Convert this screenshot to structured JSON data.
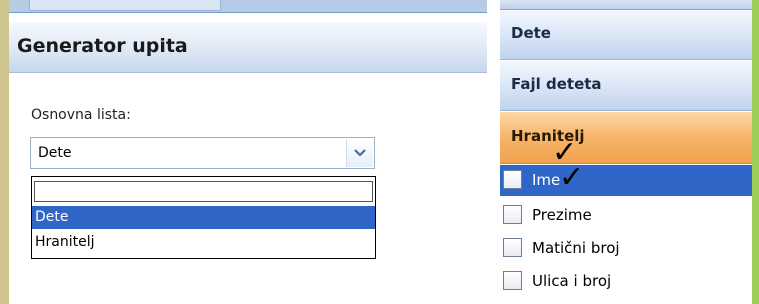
{
  "query_panel": {
    "title": "Generator upita",
    "base_list_label": "Osnovna lista:",
    "selected_value": "Dete",
    "options": [
      "",
      "Dete",
      "Hranitelj"
    ]
  },
  "field_panel": {
    "categories": [
      "Dete",
      "Fajl deteta",
      "Hranitelj"
    ],
    "active_category": "Hranitelj",
    "fields": [
      {
        "label": "Ime",
        "checked": false,
        "selected": true
      },
      {
        "label": "Prezime",
        "checked": false,
        "selected": false
      },
      {
        "label": "Matični broj",
        "checked": false,
        "selected": false
      },
      {
        "label": "Ulica i broj",
        "checked": false,
        "selected": false
      }
    ]
  },
  "colors": {
    "selection": "#3166c9",
    "active_category": "#f7b267",
    "header_blue": "#c6d6ee"
  }
}
